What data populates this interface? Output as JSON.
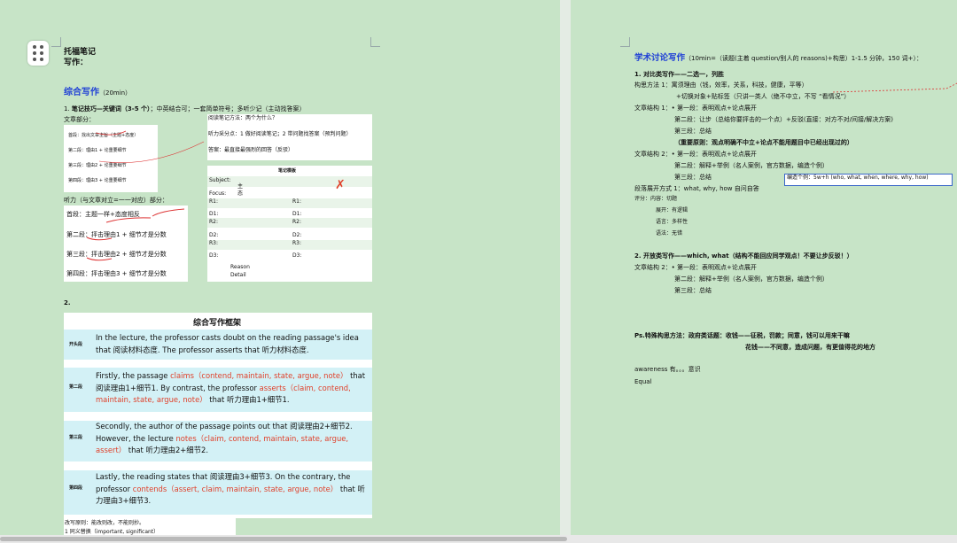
{
  "left": {
    "title1": "托福笔记",
    "title2": "写作：",
    "integrated_title": "综合写作",
    "integrated_time": "（20min）",
    "tip1_num": "1.",
    "tip1_bold": "笔记技巧—关键词（3-5 个）",
    "tip1_rest": "；中英结合可；一套简单符号；多听少记（主动找答案）",
    "reading_part": "文章部分：",
    "reading_card": [
      {
        "prefix": "首段：",
        "text": "找出文章主旨（主题+态度）"
      },
      {
        "prefix": "第二段：",
        "text": "理由1 + 论重要细节"
      },
      {
        "prefix": "第三段：",
        "text": "理由2 + 论重要细节"
      },
      {
        "prefix": "第四段：",
        "text": "理由3 + 论重要细节"
      }
    ],
    "reading_method": "阅读笔记方法：两个为什么？",
    "listen_points": "听力采分点：1 做好阅读笔记；2 带问题找答案（预判问题）",
    "answer": "答案：最直接最强烈的回答（反驳）",
    "note_template_title": "笔记模板",
    "subject_label": "Subject:",
    "focus_label": "Focus:",
    "handwritten_1": "主",
    "handwritten_2": "态",
    "template_rows_left": [
      "R1:",
      "D1:",
      "R2:",
      "D2:",
      "R3:",
      "D3:"
    ],
    "template_rows_right": [
      "R1:",
      "D1:",
      "R2:",
      "D2:",
      "R3:",
      "D3:"
    ],
    "reason_label": "Reason",
    "detail_label": "Detail",
    "listening_part": "听力（与文章对立=一一对应）部分：",
    "listening_card": [
      "首段：主题一样+态度相反",
      "第二段：抨击理由1 + 细节才是分数",
      "第三段：抨击理由2 + 细节才是分数",
      "第四段：抨击理由3 + 细节才是分数"
    ],
    "section2_num": "2.",
    "framework_title": "综合写作框架",
    "framework_rows": [
      {
        "label": "开头段",
        "text": "In the lecture, the professor casts doubt on the reading passage's idea that 阅读材料态度. The professor asserts that 听力材料态度."
      },
      {
        "label": "第二段",
        "text_a": "Firstly, the passage ",
        "red_a": "claims（contend, maintain, state, argue, note）",
        "text_b": " that 阅读理由1+细节1. By contrast, the professor ",
        "red_b": "asserts（claim, contend, maintain, state, argue, note）",
        "text_c": " that 听力理由1+细节1."
      },
      {
        "label": "第三段",
        "text_a": "Secondly, the author of the passage points out that 阅读理由2+细节2. However, the lecture ",
        "red_a": "notes（claim, contend, maintain, state, argue, assert）",
        "text_b": " that 听力理由2+细节2."
      },
      {
        "label": "第四段",
        "text_a": "Lastly, the reading states that 阅读理由3+细节3. On the contrary, the professor ",
        "red_a": "contends（assert, claim, maintain, state, argue, note）",
        "text_b": " that 听力理由3+细节3."
      }
    ],
    "rewrite_principle": "改写原则：能改则改，不能则抄。",
    "rewrite_1": "1 同义替换（important, significant）"
  },
  "right": {
    "academic_title": "学术讨论写作",
    "academic_rest": "（10min=（读题(主着 question/别人的 reasons)+构思）1-1.5 分钟，150 词+）：",
    "lines": [
      {
        "id": "r1",
        "text": "1.  对比类写作——二选一，列胜",
        "bold": true
      },
      {
        "id": "r2",
        "text": "构思方法 1：寓须理由（钱，效率，关系，科技，健康，平等）"
      },
      {
        "id": "r3",
        "text": "+切换对象+贴标签（只讲一类人（绝不中立，不写 “看情况”）"
      },
      {
        "id": "r4",
        "text": "文章结构 1：• 第一段：表明观点+论点展开"
      },
      {
        "id": "r5",
        "text": "第二段：让步（总结你要抨击的一个点）+反驳(直接：对方不对/间接/解决方案)"
      },
      {
        "id": "r6",
        "text": "第三段：总结"
      },
      {
        "id": "r7",
        "text": "（重要原则：观点明确不中立+论点不能用题目中已经出现过的）",
        "bold": true
      },
      {
        "id": "r8",
        "text": "文章结构 2：• 第一段：表明观点+论点展开"
      },
      {
        "id": "r9",
        "text": "第二段：解释+举例（名人案例，官方数据，编造个例）"
      },
      {
        "id": "r10",
        "text": "第三段：总结"
      },
      {
        "id": "r11",
        "text": "段落展开方式 1：what, why, how  自问自答"
      },
      {
        "id": "r12",
        "text": "评分：内容：切题"
      },
      {
        "id": "r13",
        "text": "展开：有逻辑"
      },
      {
        "id": "r14",
        "text": "语言：多样性"
      },
      {
        "id": "r15",
        "text": "语法：无错"
      },
      {
        "id": "r16",
        "text": "2.  开放类写作——which, what（结构不能回应同学观点！不要让步反驳！）",
        "bold": true
      },
      {
        "id": "r17",
        "text": "文章结构 2：• 第一段：表明观点+论点展开"
      },
      {
        "id": "r18",
        "text": "第二段：解释+举例（名人案例，官方数据，编造个例）"
      },
      {
        "id": "r19",
        "text": "第三段：总结"
      },
      {
        "id": "r20",
        "text": "Ps.特殊构思方法：政府类话题：收钱——征税，罚款；同意，钱可以用来干嘛",
        "bold": true
      },
      {
        "id": "r21",
        "text": "花钱——不同意，造成问题，有更值得花的地方",
        "bold": true
      },
      {
        "id": "r22",
        "text": "awareness 有。。。意识"
      },
      {
        "id": "r23",
        "text": "Equal"
      }
    ],
    "comment_text": "编造个例：5w+h (who, what, when, where, why, how)"
  }
}
